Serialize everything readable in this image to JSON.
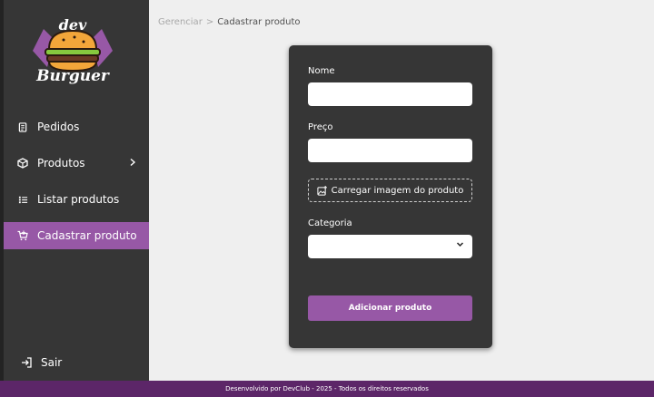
{
  "logo": {
    "top": "dev",
    "bottom": "Burguer"
  },
  "sidebar": {
    "items": [
      {
        "label": "Pedidos",
        "icon": "receipt-icon"
      },
      {
        "label": "Produtos",
        "icon": "box-icon",
        "has_submenu": true
      },
      {
        "label": "Listar produtos",
        "icon": "list-icon"
      },
      {
        "label": "Cadastrar produto",
        "icon": "cart-plus-icon",
        "active": true
      }
    ],
    "logout_label": "Sair"
  },
  "breadcrumb": {
    "parent": "Gerenciar",
    "separator": ">",
    "current": "Cadastrar produto"
  },
  "form": {
    "name_label": "Nome",
    "name_value": "",
    "price_label": "Preço",
    "price_value": "",
    "upload_label": "Carregar imagem do produto",
    "category_label": "Categoria",
    "category_value": "",
    "submit_label": "Adicionar produto"
  },
  "footer": {
    "text": "Desenvolvido por DevClub - 2025 - Todos os direitos reservados"
  },
  "colors": {
    "accent": "#9758a6",
    "sidebar": "#363636",
    "footer": "#5c2668",
    "page_bg": "#efefef"
  }
}
